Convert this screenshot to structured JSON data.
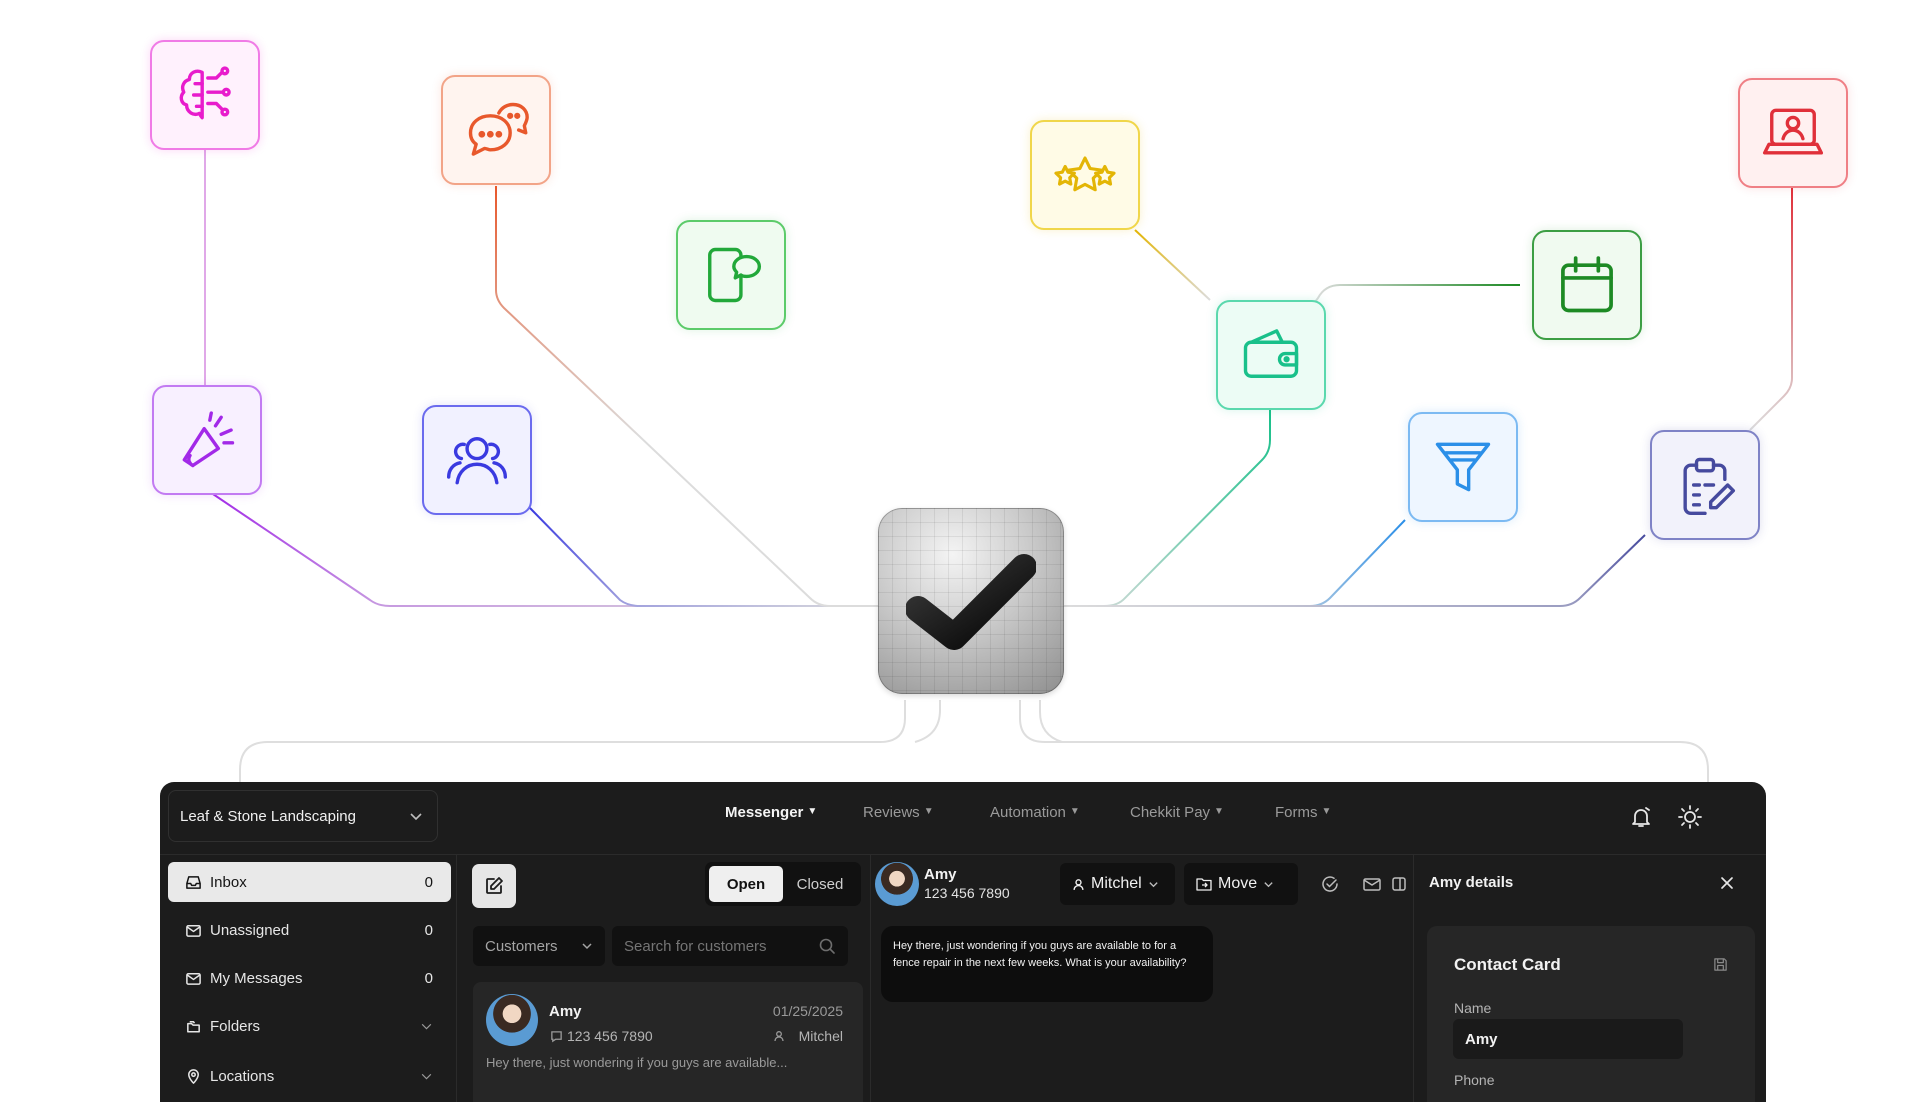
{
  "colors": {
    "brain": "#e81ccc",
    "chat": "#e8582c",
    "phone_chat": "#22a83a",
    "stars": "#e3b505",
    "profile": "#e0303a",
    "megaphone": "#a229e8",
    "team": "#3a3ae0",
    "wallet": "#19c08a",
    "calendar": "#1d8a24",
    "funnel": "#2b8fe8",
    "clipboard": "#464a9e"
  },
  "features": [
    {
      "icon": "brain-icon"
    },
    {
      "icon": "chat-bubbles-icon"
    },
    {
      "icon": "phone-chat-icon"
    },
    {
      "icon": "stars-icon"
    },
    {
      "icon": "profile-laptop-icon"
    },
    {
      "icon": "megaphone-icon"
    },
    {
      "icon": "team-icon"
    },
    {
      "icon": "wallet-icon"
    },
    {
      "icon": "calendar-icon"
    },
    {
      "icon": "funnel-icon"
    },
    {
      "icon": "clipboard-edit-icon"
    }
  ],
  "topbar": {
    "workspace": "Leaf & Stone Landscaping",
    "nav": [
      "Messenger",
      "Reviews",
      "Automation",
      "Chekkit Pay",
      "Forms"
    ]
  },
  "sidebar": {
    "items": [
      {
        "label": "Inbox",
        "count": "0",
        "icon": "inbox-icon"
      },
      {
        "label": "Unassigned",
        "count": "0",
        "icon": "unassigned-icon"
      },
      {
        "label": "My Messages",
        "count": "0",
        "icon": "mail-icon"
      },
      {
        "label": "Folders",
        "icon": "folders-icon"
      },
      {
        "label": "Locations",
        "icon": "location-pin-icon"
      }
    ]
  },
  "conversations": {
    "tabs": {
      "open": "Open",
      "closed": "Closed"
    },
    "filter": "Customers",
    "search_placeholder": "Search for customers",
    "items": [
      {
        "name": "Amy",
        "phone": "123 456 7890",
        "date": "01/25/2025",
        "assignee": "Mitchel",
        "preview": "Hey there, just wondering if you guys are available..."
      }
    ]
  },
  "thread": {
    "contact_name": "Amy",
    "contact_phone": "123 456 7890",
    "assignee": "Mitchel",
    "move_label": "Move",
    "message": "Hey there, just wondering if you guys are available to for a fence repair in the next few weeks. What is your availability?"
  },
  "details": {
    "title": "Amy details",
    "card_title": "Contact Card",
    "name_label": "Name",
    "name_value": "Amy",
    "phone_label": "Phone"
  }
}
